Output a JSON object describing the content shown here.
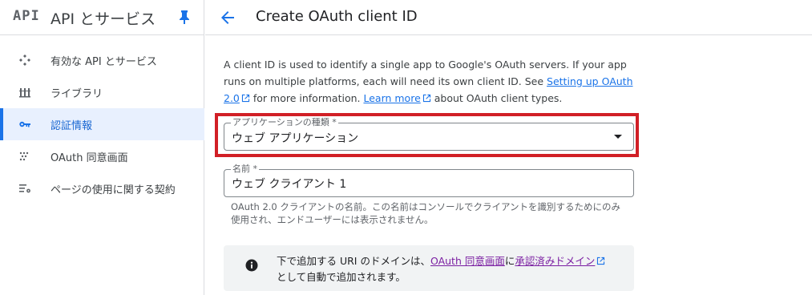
{
  "sidebar": {
    "logo": "API",
    "title": "API とサービス",
    "items": [
      {
        "label": "有効な API とサービス",
        "icon": "api-diamond-icon",
        "active": false
      },
      {
        "label": "ライブラリ",
        "icon": "library-icon",
        "active": false
      },
      {
        "label": "認証情報",
        "icon": "key-icon",
        "active": true
      },
      {
        "label": "OAuth 同意画面",
        "icon": "dots-grid-icon",
        "active": false
      },
      {
        "label": "ページの使用に関する契約",
        "icon": "settings-list-icon",
        "active": false
      }
    ]
  },
  "header": {
    "title": "Create OAuth client ID"
  },
  "intro": {
    "part1": "A client ID is used to identify a single app to Google's OAuth servers. If your app runs on multiple platforms, each will need its own client ID. See ",
    "link1": "Setting up OAuth 2.0",
    "part2": " for more information. ",
    "link2": "Learn more",
    "part3": " about OAuth client types."
  },
  "form": {
    "app_type_label": "アプリケーションの種類 *",
    "app_type_value": "ウェブ アプリケーション",
    "name_label": "名前 *",
    "name_value": "ウェブ クライアント 1",
    "name_hint": "OAuth 2.0 クライアントの名前。この名前はコンソールでクライアントを識別するためにのみ使用され、エンドユーザーには表示されません。"
  },
  "notice": {
    "part1": "下で追加する URI のドメインは、",
    "link1": "OAuth 同意画面",
    "part2": "に",
    "link2": "承認済みドメイン",
    "part3": "として自動で追加されます。"
  },
  "colors": {
    "accent": "#1a73e8",
    "active_bg": "#e8f0fe",
    "highlight": "#d11f26",
    "notice_bg": "#f1f3f4"
  }
}
